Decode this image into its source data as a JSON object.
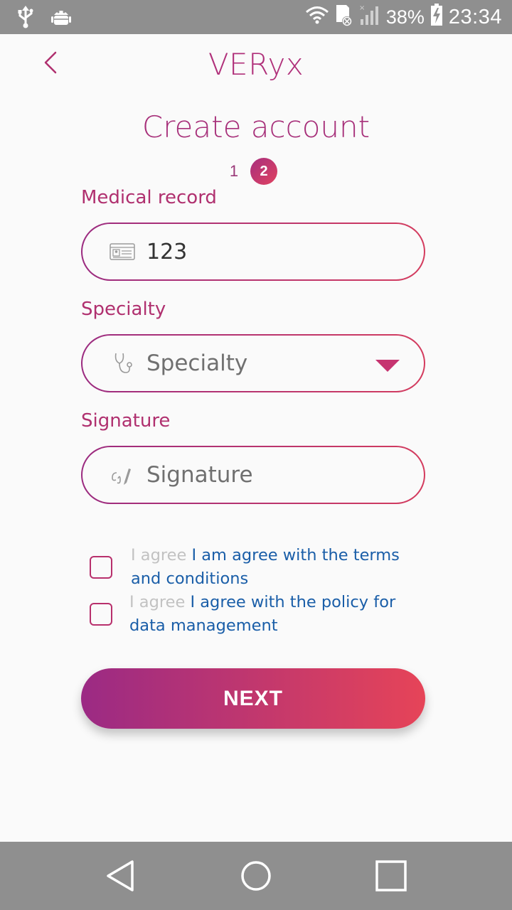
{
  "status_bar": {
    "battery": "38%",
    "time": "23:34",
    "icons": [
      "usb-icon",
      "android-debug-icon",
      "wifi-icon",
      "sd-card-icon",
      "signal-icon",
      "battery-charging-icon"
    ]
  },
  "header": {
    "app_title": "VERyx",
    "back_icon": "chevron-left-icon"
  },
  "page": {
    "title": "Create account",
    "steps": [
      "1",
      "2"
    ],
    "current_step": 2
  },
  "form": {
    "medical_record": {
      "label": "Medical record",
      "value": "123",
      "icon": "id-card-icon"
    },
    "specialty": {
      "label": "Specialty",
      "placeholder": "Specialty",
      "icon": "stethoscope-icon"
    },
    "signature": {
      "label": "Signature",
      "placeholder": "Signature",
      "icon": "signature-pen-icon"
    }
  },
  "agreements": {
    "terms": {
      "prefix": "I agree",
      "text": "I am agree with the terms and conditions",
      "checked": false
    },
    "policy": {
      "prefix": "I agree",
      "text": "I agree with the policy for data management",
      "checked": false
    }
  },
  "actions": {
    "next_label": "NEXT"
  },
  "colors": {
    "brand_primary": "#a7307a",
    "gradient_start": "#9b2a84",
    "gradient_end": "#e64458",
    "link_blue": "#1a5ea8",
    "system_bar": "#8f8f8f"
  }
}
